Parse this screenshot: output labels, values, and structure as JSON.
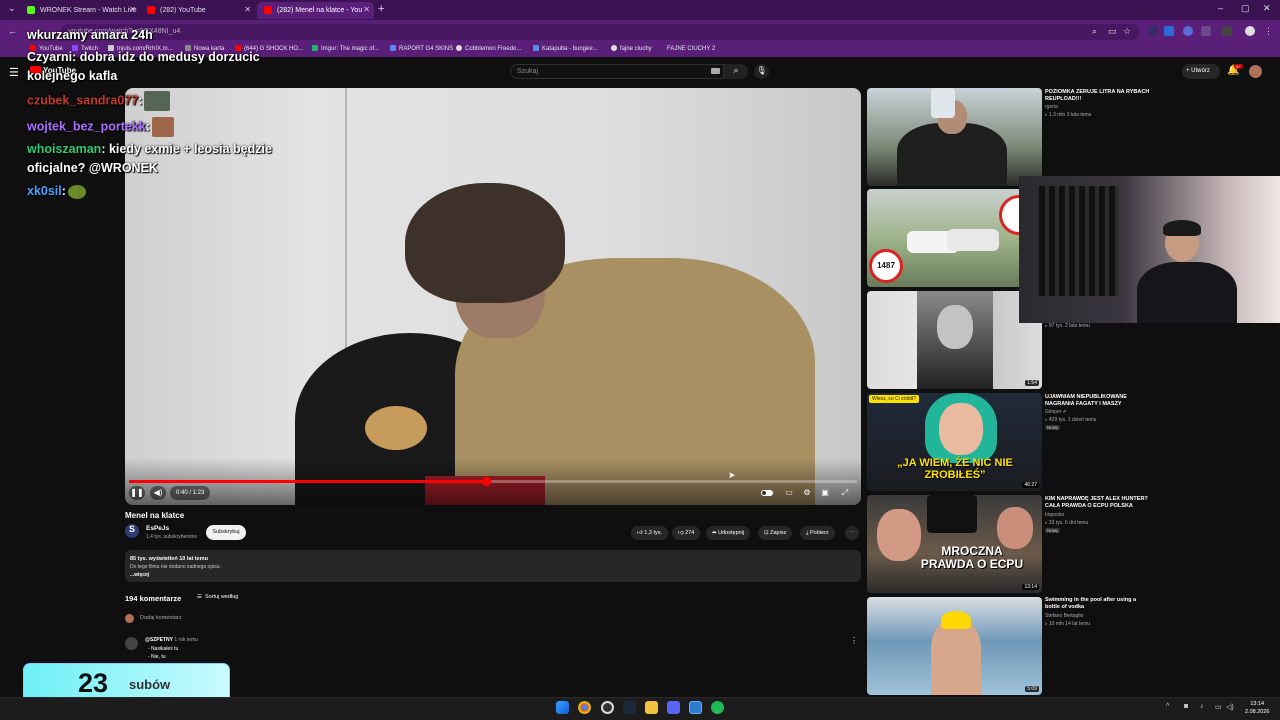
{
  "browser": {
    "tabs": [
      {
        "title": "WRONEK Stream - Watch Live",
        "color": "#53fc18"
      },
      {
        "title": "(282) YouTube",
        "color": "#ff0000"
      },
      {
        "title": "(282) Menel na klatce - You",
        "color": "#ff0000"
      }
    ],
    "url": "youtube.com/watch?v=9GX48NI_u4",
    "bookmarks": [
      "YouTube",
      "Twitch",
      "tnjuls.com/RrhIX.m...",
      "Nowa karta",
      "(644) G SHOCK HO...",
      "Imgur: The magic of...",
      "RAPORT G4 SKINS",
      "Cobblemon Freedo...",
      "Katapulta - bungee...",
      "fajne ciuchy",
      "FAJNE CIUCHY 2"
    ]
  },
  "yt": {
    "logo": "YouTube",
    "search_placeholder": "Szukaj",
    "create_label": "Utwórz",
    "notif_count": "9+"
  },
  "video": {
    "title": "Menel na klatce",
    "time": "0:40 / 1:23",
    "progress": 0.49,
    "channel": "EsPeJs",
    "channel_initial": "S",
    "subs": "1,4 tys. subskrybentów",
    "subscribe_label": "Subskrybuj",
    "likes": "1,3 tys.",
    "dislikes": "274",
    "share": "Udostępnij",
    "save": "Zapisz",
    "download": "Pobierz",
    "desc_stats": "85 tys. wyświetleń  10 lat temu",
    "desc_text": "Do tego filmu nie dodano żadnego opisu.",
    "desc_more": "...więcej"
  },
  "comments": {
    "count": "194 komentarze",
    "sort": "Sortuj według",
    "add": "Dodaj komentarz",
    "first_author": "@SZPETNY",
    "first_time": "1 rok temu",
    "first_lines": [
      "- Nasikałeś tu",
      "- Nie, tu"
    ]
  },
  "sidebar": [
    {
      "title": "POZIOMKA ZERUJE LITRA NA RYBACH REUPLOAD!!!",
      "channel": "rgeria",
      "meta": "1,3 mln  3 lata temu",
      "duration": "",
      "new": "",
      "colors": [
        "#7c8a78",
        "#2b2b28"
      ]
    },
    {
      "title": "",
      "channel": "",
      "meta": "",
      "duration": "",
      "new": "",
      "colors": [
        "#9fb48a",
        "#6a7d5c"
      ],
      "badge": "1487"
    },
    {
      "title": "",
      "channel": "",
      "meta": "97 tys.  2 lata temu",
      "duration": "1:54",
      "new": "",
      "colors": [
        "#dcdcdc",
        "#2a2a2a"
      ]
    },
    {
      "title": "UJAWNIAM NIEPUBLIKOWANE NAGRANIA FAGATY I MASZY",
      "channel": "Gimper",
      "meta": "429 tys.  1 dzień temu",
      "duration": "46:27",
      "new": "Nowy",
      "colors": [
        "#21b59a",
        "#1b1b20"
      ],
      "caption": "„JA WIEM, ŻE NIC NIE ZROBIŁEŚ”"
    },
    {
      "title": "KIM NAPRAWDĘ JEST ALEX HUNTER? CAŁA PRAWDA O ECPU POLSKA",
      "channel": "Impostor",
      "meta": "33 tys.  6 dni temu",
      "duration": "13:14",
      "new": "Nowy",
      "colors": [
        "#3b3b3b",
        "#d6c7b5"
      ],
      "caption": "MROCZNA PRAWDA O ECPU"
    },
    {
      "title": "Swimming in the pool after using a bottle of vodka",
      "channel": "Stefano Bertaglio",
      "meta": "10 mln  14 lat temu",
      "duration": "5:09",
      "new": "",
      "colors": [
        "#6f98b8",
        "#9ec2d8"
      ]
    }
  ],
  "chat": [
    {
      "user": "",
      "text": "wkurzamy amara 24h",
      "color": "#ffffff"
    },
    {
      "user": "Czyarni",
      "text": ": dobra idz do medusy dorzucic",
      "color": "#ffffff"
    },
    {
      "user": "",
      "text": "kolejnego kafla",
      "color": "#ffffff"
    },
    {
      "user": "czubek_sandra077",
      "text": ":",
      "color": "#c0392b"
    },
    {
      "user": "wojtek_bez_portekk",
      "text": ":",
      "color": "#a970ff"
    },
    {
      "user": "whoiszaman",
      "text": ": kiedy exmie + leosia będzie",
      "color": "#2ecc71"
    },
    {
      "user": "",
      "text": "oficjalne? @WRONEK",
      "color": "#ffffff"
    },
    {
      "user": "xk0sil",
      "text": ":",
      "color": "#4aa3ff"
    }
  ],
  "sub_counter": {
    "number": "23",
    "label": "subów"
  },
  "clock": {
    "time": "13:14",
    "date": "2.08.2026"
  }
}
